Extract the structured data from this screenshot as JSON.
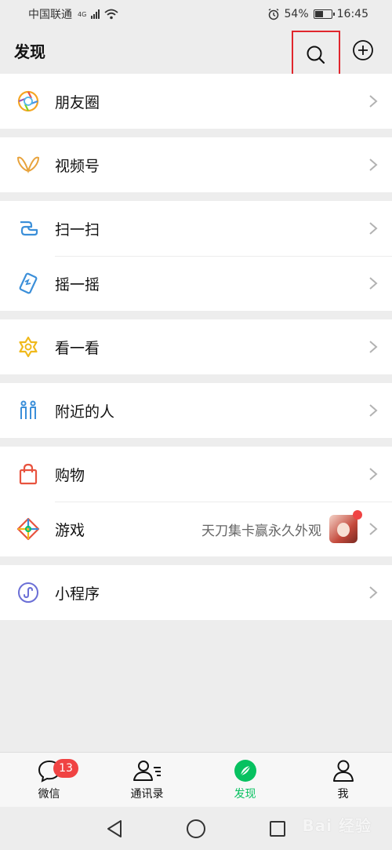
{
  "status_bar": {
    "carrier": "中国联通",
    "network": "4G",
    "battery": "54%",
    "battery_level": 0.54,
    "time": "16:45"
  },
  "header": {
    "title": "发现"
  },
  "groups": [
    {
      "items": [
        {
          "label": "朋友圈",
          "icon": "moments-icon"
        }
      ]
    },
    {
      "items": [
        {
          "label": "视频号",
          "icon": "channels-icon"
        }
      ]
    },
    {
      "items": [
        {
          "label": "扫一扫",
          "icon": "scan-icon"
        },
        {
          "label": "摇一摇",
          "icon": "shake-icon"
        }
      ]
    },
    {
      "items": [
        {
          "label": "看一看",
          "icon": "top-stories-icon"
        }
      ]
    },
    {
      "items": [
        {
          "label": "附近的人",
          "icon": "people-nearby-icon"
        }
      ]
    },
    {
      "items": [
        {
          "label": "购物",
          "icon": "shopping-bag-icon"
        },
        {
          "label": "游戏",
          "icon": "games-icon",
          "extra": "天刀集卡赢永久外观"
        }
      ]
    },
    {
      "items": [
        {
          "label": "小程序",
          "icon": "mini-programs-icon"
        }
      ]
    }
  ],
  "tab_bar": {
    "tabs": [
      {
        "label": "微信",
        "icon": "chat-bubble-icon",
        "badge": "13"
      },
      {
        "label": "通讯录",
        "icon": "contacts-icon"
      },
      {
        "label": "发现",
        "icon": "compass-icon",
        "active": true
      },
      {
        "label": "我",
        "icon": "person-icon"
      }
    ]
  },
  "watermark": "Bai 经验",
  "colors": {
    "accent_green": "#07c160",
    "badge_red": "#f04343",
    "highlight_box": "#e0262d",
    "background": "#ededed"
  }
}
